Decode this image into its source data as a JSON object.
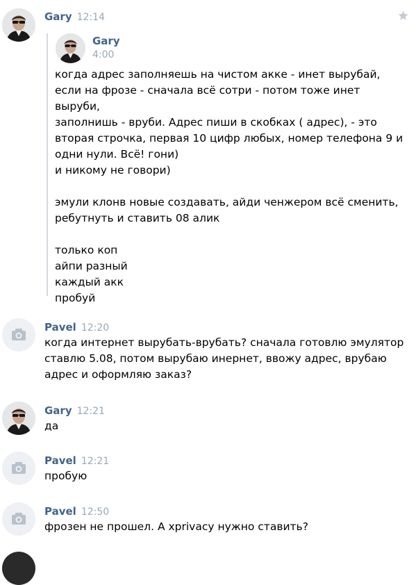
{
  "messages": [
    {
      "author": "Gary",
      "time": "12:14",
      "avatar": "gary-avatar",
      "forwarded": {
        "author": "Gary",
        "time": "4:00",
        "text": "когда адрес заполняешь на чистом акке - инет вырубай,\nесли на фрозе - сначала всё сотри - потом тоже инет выруби,\nзаполнишь - вруби. Адрес пиши в скобках ( адрес), - это\nвторая строчка, первая 10 цифр любых, номер телефона 9 и\nодни нули. Всё! гони)\nи никому не говори)\n\nэмули клонв новые создавать, айди ченжером всё сменить,\nребутнуть и ставить 08 алик\n\nтолько коп\nайпи разный\nкаждый акк\nпробуй"
      }
    },
    {
      "author": "Pavel",
      "time": "12:20",
      "avatar": "camera-icon",
      "text": "когда интернет вырубать-врубать? сначала готовлю эмулятор\nставлю 5.08, потом вырубаю инернет, ввожу адрес, врубаю\nадрес и оформляю заказ?"
    },
    {
      "author": "Gary",
      "time": "12:21",
      "avatar": "gary-avatar",
      "text": "да"
    },
    {
      "author": "Pavel",
      "time": "12:21",
      "avatar": "camera-icon",
      "text": "пробую"
    },
    {
      "author": "Pavel",
      "time": "12:50",
      "avatar": "camera-icon",
      "text": "фрозен не прошел. А xprivacy нужно ставить?"
    }
  ],
  "colors": {
    "author": "#42648b",
    "time": "#9aa7b5",
    "forward_bar": "#d3d9de",
    "star": "#c5ccd4"
  },
  "icons": {
    "favorite": "star-icon",
    "no_photo": "camera-icon"
  }
}
